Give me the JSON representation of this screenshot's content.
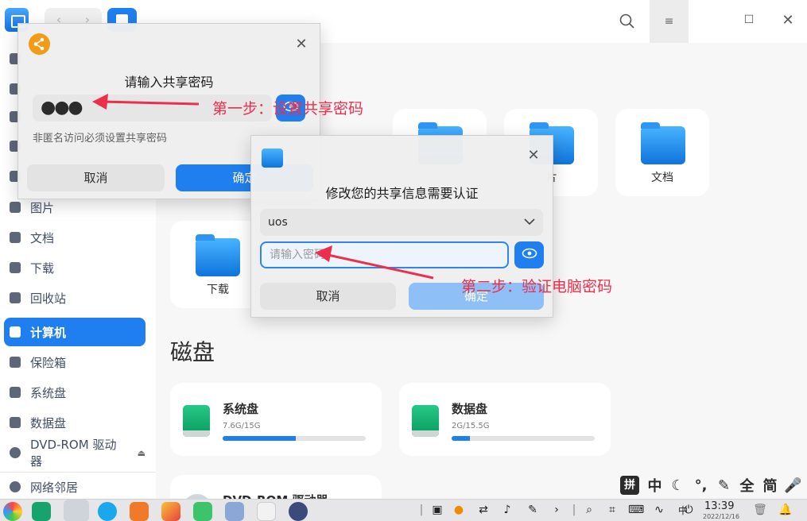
{
  "titlebar": {
    "nav_back": "‹",
    "nav_forward": "›",
    "menu_glyph": "≡",
    "min_glyph": "—",
    "max_glyph": "☐",
    "close_glyph": "✕"
  },
  "sidebar": {
    "items": [
      {
        "label": "",
        "icon": "clock-icon"
      },
      {
        "label": "",
        "icon": "home-icon"
      },
      {
        "label": "",
        "icon": "desktop-icon"
      },
      {
        "label": "",
        "icon": "video-icon"
      },
      {
        "label": "",
        "icon": "music-icon"
      },
      {
        "label": "图片",
        "icon": "image-icon"
      },
      {
        "label": "文档",
        "icon": "document-icon"
      },
      {
        "label": "下载",
        "icon": "download-icon"
      },
      {
        "label": "回收站",
        "icon": "trash-icon"
      },
      {
        "label": "计算机",
        "icon": "computer-icon"
      },
      {
        "label": "保险箱",
        "icon": "safe-icon"
      },
      {
        "label": "系统盘",
        "icon": "disk-icon"
      },
      {
        "label": "数据盘",
        "icon": "disk-icon"
      },
      {
        "label": "DVD-ROM 驱动器",
        "icon": "dvd-icon"
      },
      {
        "label": "网络邻居",
        "icon": "network-icon"
      }
    ],
    "eject_glyph": "⏏"
  },
  "main": {
    "folders": {
      "pictures": "片",
      "documents": "文档",
      "downloads": "下载"
    },
    "disks_title": "磁盘",
    "disks": [
      {
        "name": "系统盘",
        "size": "7.6G/15G",
        "used_fraction": 0.51
      },
      {
        "name": "数据盘",
        "size": "2G/15.5G",
        "used_fraction": 0.13
      },
      {
        "name": "DVD-ROM 驱动器",
        "size": "",
        "used_fraction": 0
      }
    ]
  },
  "share_dialog": {
    "title": "请输入共享密码",
    "password_value": "●●●",
    "hint": "非匿名访问必须设置共享密码",
    "cancel_label": "取消",
    "confirm_label": "确定",
    "close_glyph": "✕"
  },
  "auth_dialog": {
    "title": "修改您的共享信息需要认证",
    "user_value": "uos",
    "password_placeholder": "请输入密码",
    "cancel_label": "取消",
    "confirm_label": "确定",
    "close_glyph": "✕",
    "eye_glyph": "👁"
  },
  "annotations": {
    "step1": "第一步：设置共享密码",
    "step2": "第二步：验证电脑密码",
    "color": "#ec2f4b"
  },
  "ime_bar": {
    "items": [
      "拼",
      "中",
      "☾",
      "°,",
      "✎",
      "全",
      "简",
      "🎤"
    ]
  },
  "taskbar": {
    "clock": "13:39",
    "date": "2022/12/16"
  },
  "colors": {
    "accent": "#1f7ff0",
    "sidebar_active": "#1f7ff0"
  }
}
